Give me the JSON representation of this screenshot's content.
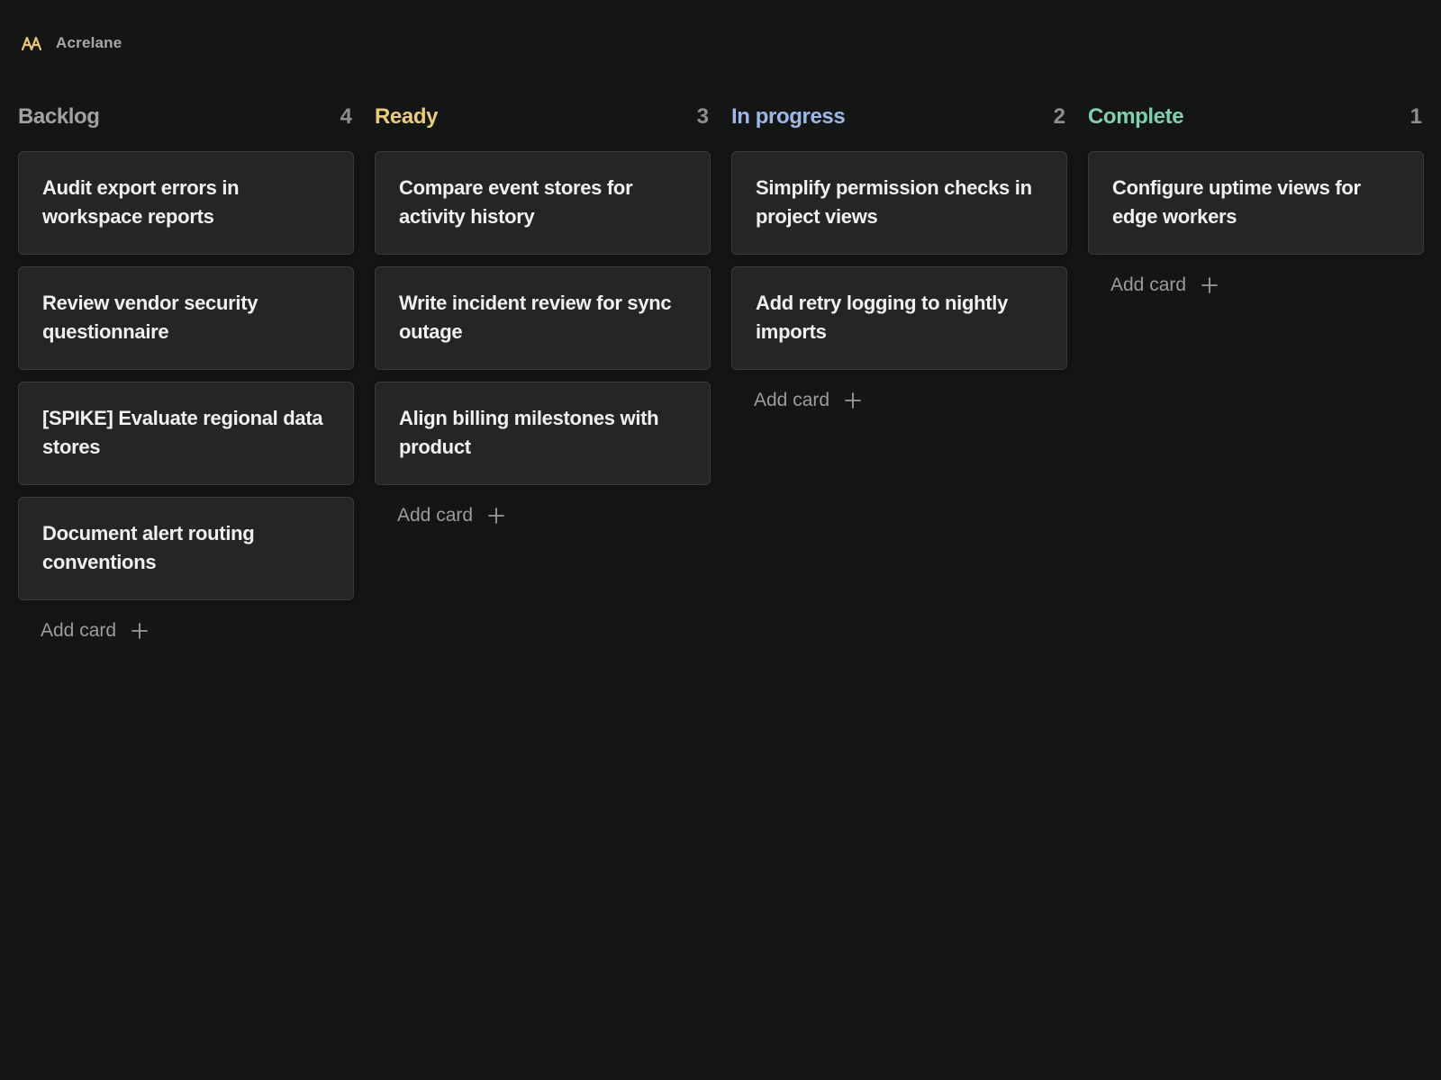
{
  "app": {
    "name": "Acrelane",
    "logo_icon": "acrelane-logo-icon",
    "logo_color": "#e6c86e"
  },
  "add_card_label": "Add card",
  "columns": [
    {
      "title": "Backlog",
      "count": "4",
      "color": "#a1a3a0",
      "cards": [
        "Audit export errors in workspace reports",
        "Review vendor security questionnaire",
        "[SPIKE] Evaluate regional data stores",
        "Document alert routing conventions"
      ]
    },
    {
      "title": "Ready",
      "count": "3",
      "color": "#e9cc79",
      "cards": [
        "Compare event stores for activity history",
        "Write incident review for sync outage",
        "Align billing milestones with product"
      ]
    },
    {
      "title": "In progress",
      "count": "2",
      "color": "#9db8e8",
      "cards": [
        "Simplify permission checks in project views",
        "Add retry logging to nightly imports"
      ]
    },
    {
      "title": "Complete",
      "count": "1",
      "color": "#7fd1ad",
      "cards": [
        "Configure uptime views for edge workers"
      ]
    }
  ]
}
